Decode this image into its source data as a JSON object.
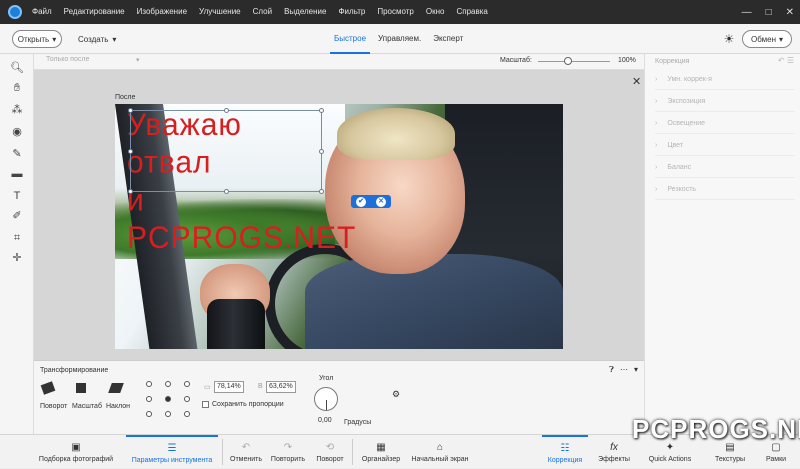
{
  "menu": {
    "items": [
      "Файл",
      "Редактирование",
      "Изображение",
      "Улучшение",
      "Слой",
      "Выделение",
      "Фильтр",
      "Просмотр",
      "Окно",
      "Справка"
    ]
  },
  "window_controls": {
    "minimize": "—",
    "maximize": "□",
    "close": "✕"
  },
  "topbar": {
    "open_label": "Открыть",
    "create_label": "Создать",
    "modes": [
      "Быстрое",
      "Управляем.",
      "Эксперт"
    ],
    "active_mode": "Быстрое",
    "share_label": "Обмен"
  },
  "options_bar": {
    "view_placeholder": "Только после",
    "zoom_label": "Масштаб:",
    "zoom_value": "100%",
    "zoom_fraction": 0.35
  },
  "canvas": {
    "after_label": "После",
    "overlay_text_line1": "Уважаю отвал",
    "overlay_text_line2": "и PCPROGS.NET",
    "commit_icon": "✔",
    "cancel_icon": "✕",
    "close_icon": "✕"
  },
  "correction_panel": {
    "title": "Коррекция",
    "items": [
      "Умн. коррек-я",
      "Экспозиция",
      "Освещение",
      "Цвет",
      "Баланс",
      "Резкость"
    ]
  },
  "transform": {
    "title": "Трансформирование",
    "tools": [
      "Поворот",
      "Масштаб",
      "Наклон"
    ],
    "width_value": "78,14%",
    "height_value": "63,62%",
    "keep_proportions": "Сохранить пропорции",
    "angle_label": "Угол",
    "angle_value": "0,00",
    "degrees_label": "Градусы"
  },
  "taskbar": {
    "items": [
      "Подборка фотографий",
      "Параметры инструмента",
      "Отменить",
      "Повторить",
      "Поворот",
      "Органайзер",
      "Начальный экран",
      "Коррекция",
      "Эффекты",
      "Quick Actions",
      "Текстуры",
      "Рамки"
    ],
    "active_left": "Параметры инструмента",
    "active_right": "Коррекция"
  },
  "watermark": "PCPROGS.NET"
}
